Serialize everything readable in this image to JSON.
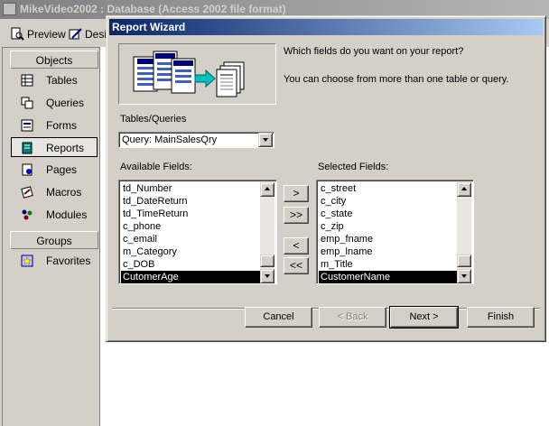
{
  "db_window": {
    "title": "MikeVideo2002 : Database (Access 2002 file format)",
    "toolbar": {
      "preview_label": "Preview",
      "design_label": "Design"
    },
    "objects_header": "Objects",
    "objects": [
      {
        "label": "Tables",
        "icon": "table-icon"
      },
      {
        "label": "Queries",
        "icon": "query-icon"
      },
      {
        "label": "Forms",
        "icon": "form-icon"
      },
      {
        "label": "Reports",
        "icon": "report-icon"
      },
      {
        "label": "Pages",
        "icon": "page-icon"
      },
      {
        "label": "Macros",
        "icon": "macro-icon"
      },
      {
        "label": "Modules",
        "icon": "module-icon"
      }
    ],
    "groups_header": "Groups",
    "groups": [
      {
        "label": "Favorites",
        "icon": "favorites-icon"
      }
    ]
  },
  "wizard": {
    "title": "Report Wizard",
    "prompt_line1": "Which fields do you want on your report?",
    "prompt_line2": "You can choose from more than one table or query.",
    "tables_label": "Tables/Queries",
    "tables_value": "Query: MainSalesQry",
    "available_label": "Available Fields:",
    "selected_label": "Selected Fields:",
    "available_fields": [
      "td_Number",
      "td_DateReturn",
      "td_TimeReturn",
      "c_phone",
      "c_email",
      "m_Category",
      "c_DOB",
      "CutomerAge"
    ],
    "available_selected": "CutomerAge",
    "selected_fields": [
      "c_street",
      "c_city",
      "c_state",
      "c_zip",
      "emp_fname",
      "emp_lname",
      "m_Title",
      "CustomerName"
    ],
    "selected_selected": "CustomerName",
    "move_buttons": {
      "add_one": ">",
      "add_all": ">>",
      "remove_one": "<",
      "remove_all": "<<"
    },
    "buttons": {
      "cancel": "Cancel",
      "back": "< Back",
      "next": "Next >",
      "finish": "Finish"
    }
  },
  "colors": {
    "dialog_title_start": "#0a246a",
    "dialog_title_end": "#a6caf0",
    "face": "#d4d0c8"
  }
}
